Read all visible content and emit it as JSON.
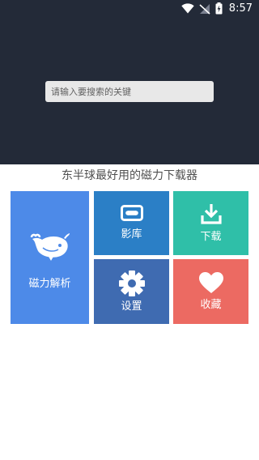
{
  "status_bar": {
    "time": "8:57",
    "icons": [
      "wifi-icon",
      "signal-off-icon",
      "battery-charging-icon"
    ]
  },
  "search": {
    "placeholder": "请输入要搜索的关键"
  },
  "tagline": "东半球最好用的磁力下载器",
  "tiles": {
    "magnet": {
      "label": "磁力解析",
      "icon": "whale-icon",
      "color": "#4d8ae8"
    },
    "library": {
      "label": "影库",
      "icon": "cassette-icon",
      "color": "#2b7fc6"
    },
    "download": {
      "label": "下载",
      "icon": "download-icon",
      "color": "#2fbfa8"
    },
    "settings": {
      "label": "设置",
      "icon": "gear-icon",
      "color": "#3f6bb1"
    },
    "favorites": {
      "label": "收藏",
      "icon": "heart-icon",
      "color": "#ec6a62"
    }
  },
  "colors": {
    "header_bg": "#232a38",
    "page_bg": "#ffffff"
  }
}
